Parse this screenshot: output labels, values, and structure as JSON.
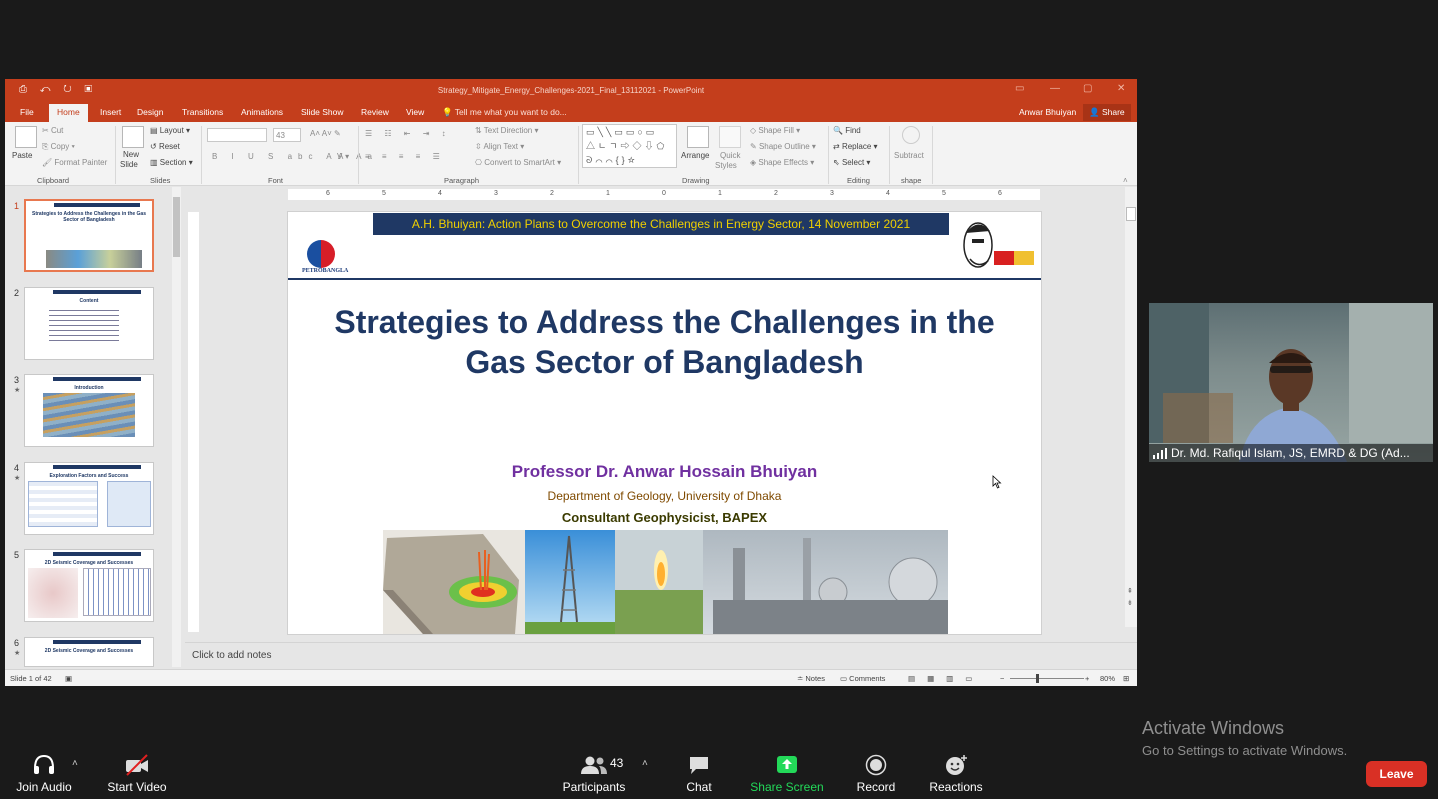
{
  "window": {
    "title": "Strategy_Mitigate_Energy_Challenges-2021_Final_13112021 - PowerPoint"
  },
  "ribbon_tabs": [
    "File",
    "Home",
    "Insert",
    "Design",
    "Transitions",
    "Animations",
    "Slide Show",
    "Review",
    "View"
  ],
  "tell_me": "Tell me what you want to do...",
  "user": "Anwar Bhuiyan",
  "share_label": "Share",
  "ribbon": {
    "clipboard": {
      "paste": "Paste",
      "cut": "Cut",
      "copy": "Copy",
      "format_painter": "Format Painter",
      "label": "Clipboard"
    },
    "slides": {
      "new_slide_1": "New",
      "new_slide_2": "Slide",
      "layout": "Layout",
      "reset": "Reset",
      "section": "Section",
      "label": "Slides"
    },
    "font": {
      "size": "43",
      "label": "Font"
    },
    "paragraph": {
      "text_direction": "Text Direction",
      "align_text": "Align Text",
      "convert": "Convert to SmartArt",
      "label": "Paragraph"
    },
    "drawing": {
      "arrange": "Arrange",
      "quick_styles_1": "Quick",
      "quick_styles_2": "Styles",
      "shape_fill": "Shape Fill",
      "shape_outline": "Shape Outline",
      "shape_effects": "Shape Effects",
      "label": "Drawing"
    },
    "editing": {
      "find": "Find",
      "replace": "Replace",
      "select": "Select",
      "label": "Editing"
    },
    "shape": {
      "subtract": "Subtract",
      "label": "shape"
    }
  },
  "thumbnails": [
    {
      "num": "1",
      "title": "Strategies to Address the Challenges in the Gas Sector of Bangladesh"
    },
    {
      "num": "2",
      "title": "Content"
    },
    {
      "num": "3",
      "title": "Introduction"
    },
    {
      "num": "4",
      "title": "Exploration Factors and Success"
    },
    {
      "num": "5",
      "title": "2D Seismic Coverage and Successes"
    },
    {
      "num": "6",
      "title": "2D Seismic Coverage and Successes"
    }
  ],
  "ruler_labels": [
    "6",
    "5",
    "4",
    "3",
    "2",
    "1",
    "0",
    "1",
    "2",
    "3",
    "4",
    "5",
    "6"
  ],
  "slide": {
    "banner": "A.H. Bhuiyan: Action Plans to Overcome the Challenges in Energy Sector,  14 November 2021",
    "logo_text": "PETROBANGLA",
    "title": "Strategies to Address the Challenges in the Gas Sector of Bangladesh",
    "author": "Professor Dr. Anwar Hossain Bhuiyan",
    "department": "Department of Geology, University of Dhaka",
    "consultant": "Consultant Geophysicist, BAPEX"
  },
  "notes_placeholder": "Click to add notes",
  "status": {
    "slide_count": "Slide 1 of 42",
    "notes": "Notes",
    "comments": "Comments",
    "zoom": "80%"
  },
  "participant": {
    "name": "Dr. Md. Rafiqul Islam, JS, EMRD & DG (Ad..."
  },
  "watermark": {
    "line1": "Activate Windows",
    "line2": "Go to Settings to activate Windows."
  },
  "zoom_toolbar": {
    "join_audio": "Join Audio",
    "start_video": "Start Video",
    "participants": "Participants",
    "participant_count": "43",
    "chat": "Chat",
    "share_screen": "Share Screen",
    "record": "Record",
    "reactions": "Reactions",
    "leave": "Leave"
  },
  "colors": {
    "ppt_accent": "#c43e1c",
    "slide_title": "#1f3864",
    "author": "#7030a0",
    "share_screen": "#23d959",
    "leave": "#d93025"
  }
}
